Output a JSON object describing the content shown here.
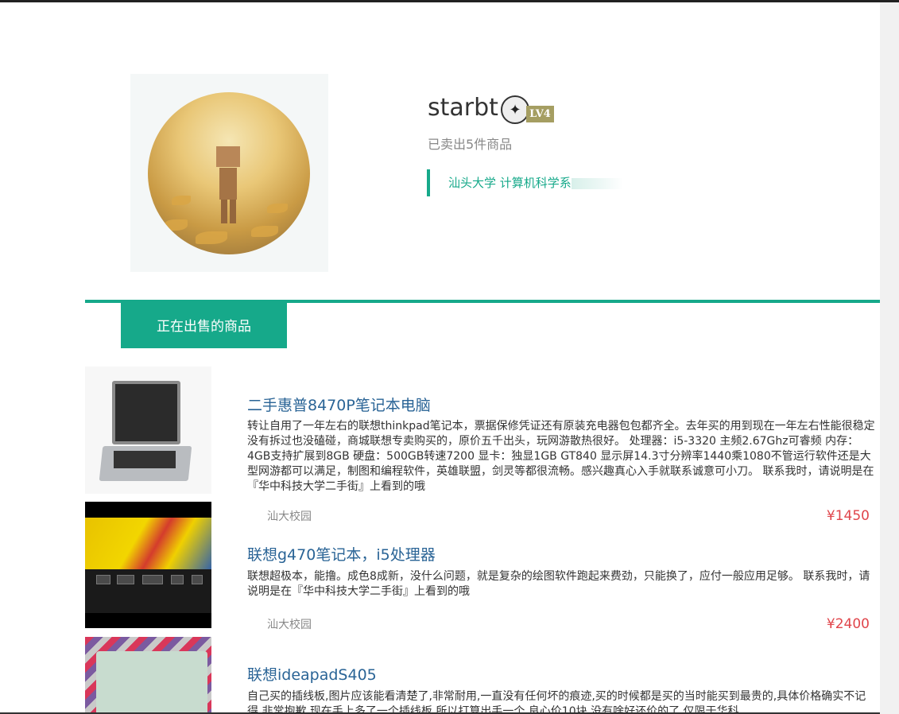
{
  "profile": {
    "username": "starbt",
    "level": "LV4",
    "sold_text": "已卖出5件商品",
    "school": "汕头大学 计算机科学系"
  },
  "tabs": {
    "active": "正在出售的商品"
  },
  "items": [
    {
      "title": "二手惠普8470P笔记本电脑",
      "desc": "转让自用了一年左右的联想thinkpad笔记本，票据保修凭证还有原装充电器包包都齐全。去年买的用到现在一年左右性能很稳定没有拆过也没磕碰，商城联想专卖购买的，原价五千出头，玩网游散热很好。 处理器：i5-3320 主频2.67Ghz可睿频 内存：4GB支持扩展到8GB 硬盘：500GB转速7200 显卡：独显1GB GT840 显示屏14.3寸分辨率1440乘1080不管运行软件还是大型网游都可以满足，制图和编程软件，英雄联盟，剑灵等都很流畅。感兴趣真心入手就联系诚意可小刀。 联系我时，请说明是在『华中科技大学二手街』上看到的哦",
      "location": "汕大校园",
      "price": "¥1450"
    },
    {
      "title": "联想g470笔记本，i5处理器",
      "desc": "联想超极本，能撸。成色8成新，没什么问题，就是复杂的绘图软件跑起来费劲，只能换了，应付一般应用足够。 联系我时，请说明是在『华中科技大学二手街』上看到的哦",
      "location": "汕大校园",
      "price": "¥2400"
    },
    {
      "title": "联想ideapadS405",
      "desc": "自己买的插线板,图片应该能看清楚了,非常耐用,一直没有任何坏的痕迹,买的时候都是买的当时能买到最贵的,具体价格确实不记得,非常抱歉,现在手上多了一个插线板,所以打算出手一个,良心价10块,没有啥好还价的了,仅限于华科"
    }
  ]
}
